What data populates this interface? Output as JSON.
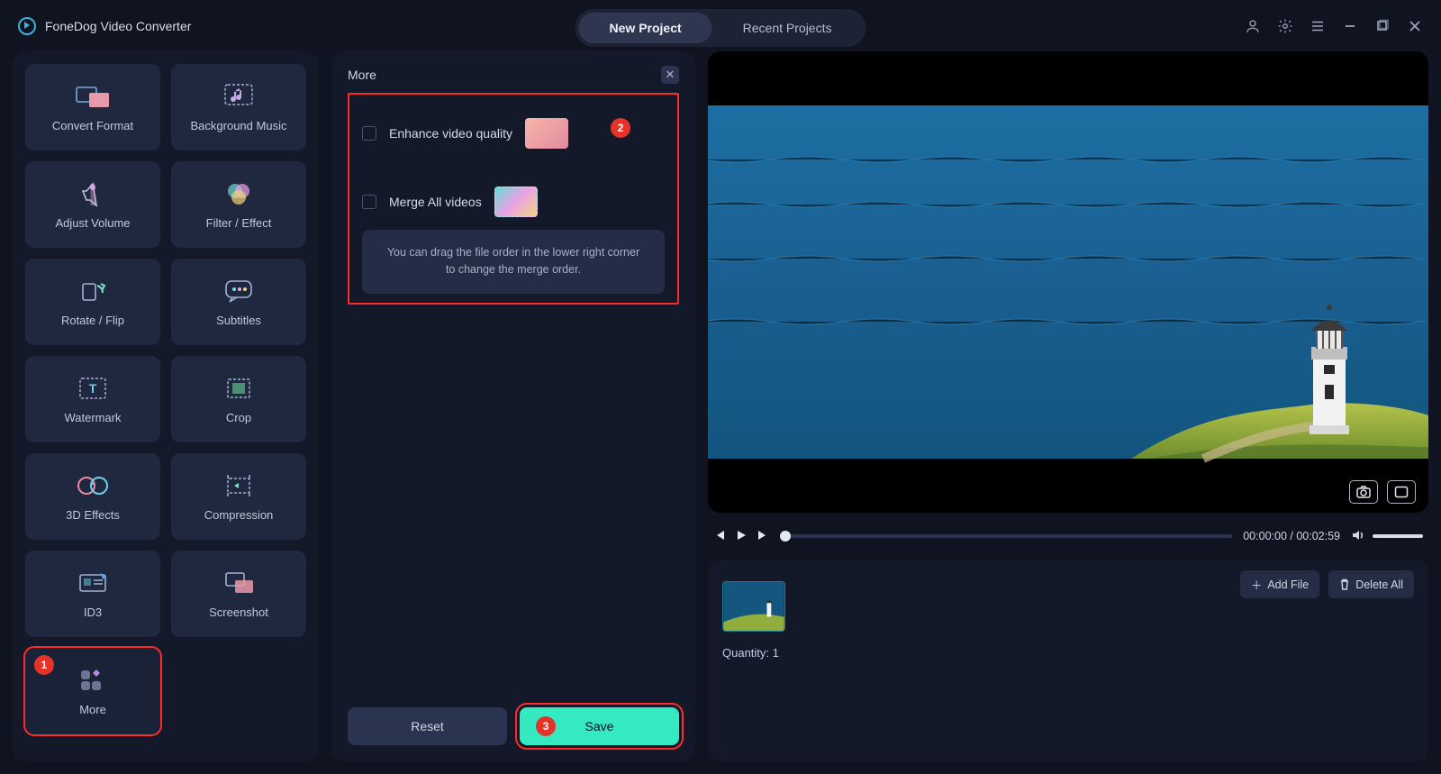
{
  "app_title": "FoneDog Video Converter",
  "tabs": {
    "new": "New Project",
    "recent": "Recent Projects"
  },
  "sidebar": [
    {
      "key": "convert-format",
      "label": "Convert Format"
    },
    {
      "key": "background-music",
      "label": "Background Music"
    },
    {
      "key": "adjust-volume",
      "label": "Adjust Volume"
    },
    {
      "key": "filter-effect",
      "label": "Filter / Effect"
    },
    {
      "key": "rotate-flip",
      "label": "Rotate / Flip"
    },
    {
      "key": "subtitles",
      "label": "Subtitles"
    },
    {
      "key": "watermark",
      "label": "Watermark"
    },
    {
      "key": "crop",
      "label": "Crop"
    },
    {
      "key": "3d-effects",
      "label": "3D Effects"
    },
    {
      "key": "compression",
      "label": "Compression"
    },
    {
      "key": "id3",
      "label": "ID3"
    },
    {
      "key": "screenshot",
      "label": "Screenshot"
    },
    {
      "key": "more",
      "label": "More"
    }
  ],
  "more_panel": {
    "title": "More",
    "enhance_label": "Enhance video quality",
    "merge_label": "Merge All videos",
    "hint": "You can drag the file order in the lower right corner to change the merge order."
  },
  "buttons": {
    "reset": "Reset",
    "save": "Save",
    "add_file": "Add File",
    "delete_all": "Delete All"
  },
  "player": {
    "time_current": "00:00:00",
    "time_total": "00:02:59"
  },
  "quantity_label": "Quantity: 1",
  "callouts": {
    "one": "1",
    "two": "2",
    "three": "3"
  },
  "colors": {
    "accent": "#35e9c0",
    "danger": "#e6332a",
    "highlight_border": "#ff2a2a"
  }
}
